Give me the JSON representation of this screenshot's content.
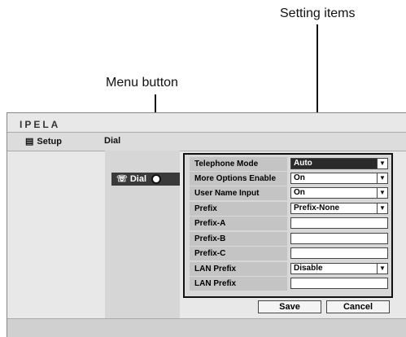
{
  "annotations": {
    "setting_items": "Setting items",
    "menu_button": "Menu button"
  },
  "brand": {
    "logo": "IPELA"
  },
  "nav": {
    "setup_label": "Setup",
    "setup_icon": "toolbox-icon",
    "current": "Dial"
  },
  "sidebar": {
    "dial_button_label": "Dial",
    "dial_icon": "telephone-icon"
  },
  "settings": {
    "rows": [
      {
        "label": "Telephone Mode",
        "type": "select",
        "value": "Auto",
        "highlight": true
      },
      {
        "label": "More Options Enable",
        "type": "select",
        "value": "On"
      },
      {
        "label": "User Name Input",
        "type": "select",
        "value": "On"
      },
      {
        "label": "Prefix",
        "type": "select",
        "value": "Prefix-None"
      },
      {
        "label": "Prefix-A",
        "type": "text",
        "value": ""
      },
      {
        "label": "Prefix-B",
        "type": "text",
        "value": ""
      },
      {
        "label": "Prefix-C",
        "type": "text",
        "value": ""
      },
      {
        "label": "LAN Prefix",
        "type": "select",
        "value": "Disable"
      },
      {
        "label": "LAN Prefix",
        "type": "text",
        "value": ""
      }
    ]
  },
  "actions": {
    "save_label": "Save",
    "cancel_label": "Cancel"
  }
}
